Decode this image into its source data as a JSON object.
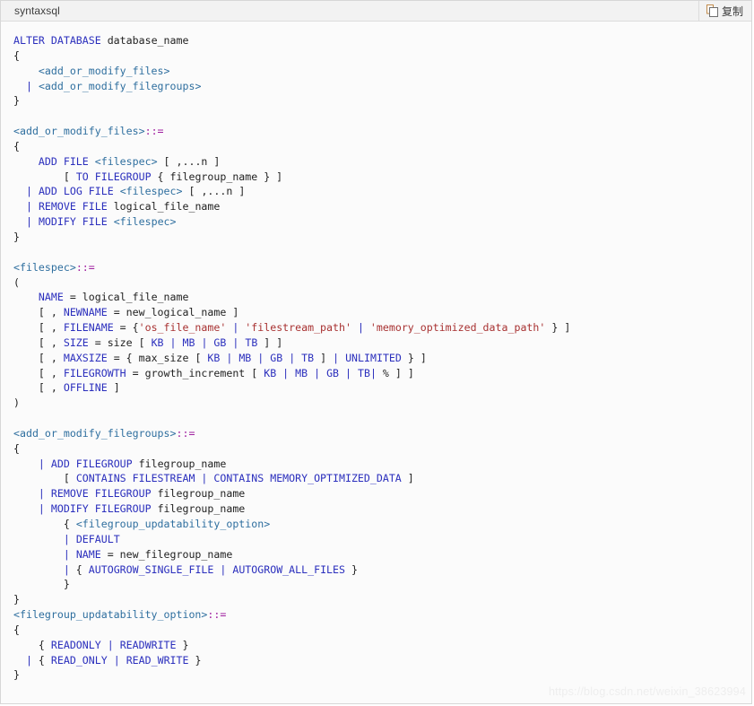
{
  "header": {
    "language_label": "syntaxsql",
    "copy_button_label": "复制",
    "copy_icon": "copy-pages-icon"
  },
  "watermark": {
    "text": "https://blog.csdn.net/weixin_38623994"
  },
  "colors": {
    "keyword": "#2b2fbd",
    "placeholder": "#2f6f9f",
    "operator": "#a020a0",
    "string": "#a83232",
    "plain": "#222222",
    "card_background": "#fbfbfb",
    "header_background": "#f2f2f2",
    "border": "#d7d7d7",
    "watermark": "#eeeeee"
  },
  "code": {
    "language": "syntaxsql",
    "lines": [
      [
        {
          "t": "ALTER DATABASE ",
          "c": "k"
        },
        {
          "t": "database_name",
          "c": "pn"
        }
      ],
      [
        {
          "t": "{",
          "c": "pn"
        }
      ],
      [
        {
          "t": "    ",
          "c": "pn"
        },
        {
          "t": "<add_or_modify_files>",
          "c": "ph"
        }
      ],
      [
        {
          "t": "  ",
          "c": "pn"
        },
        {
          "t": "|",
          "c": "pl"
        },
        {
          "t": " ",
          "c": "pn"
        },
        {
          "t": "<add_or_modify_filegroups>",
          "c": "ph"
        }
      ],
      [
        {
          "t": "}",
          "c": "pn"
        }
      ],
      [],
      [
        {
          "t": "<add_or_modify_files>",
          "c": "ph"
        },
        {
          "t": "::=",
          "c": "op"
        }
      ],
      [
        {
          "t": "{",
          "c": "pn"
        }
      ],
      [
        {
          "t": "    ",
          "c": "pn"
        },
        {
          "t": "ADD FILE ",
          "c": "k"
        },
        {
          "t": "<filespec>",
          "c": "ph"
        },
        {
          "t": " [ ,...n ]",
          "c": "pn"
        }
      ],
      [
        {
          "t": "        [ ",
          "c": "pn"
        },
        {
          "t": "TO FILEGROUP",
          "c": "k"
        },
        {
          "t": " { filegroup_name } ]",
          "c": "pn"
        }
      ],
      [
        {
          "t": "  ",
          "c": "pn"
        },
        {
          "t": "|",
          "c": "pl"
        },
        {
          "t": " ",
          "c": "pn"
        },
        {
          "t": "ADD LOG FILE ",
          "c": "k"
        },
        {
          "t": "<filespec>",
          "c": "ph"
        },
        {
          "t": " [ ,...n ]",
          "c": "pn"
        }
      ],
      [
        {
          "t": "  ",
          "c": "pn"
        },
        {
          "t": "|",
          "c": "pl"
        },
        {
          "t": " ",
          "c": "pn"
        },
        {
          "t": "REMOVE FILE ",
          "c": "k"
        },
        {
          "t": "logical_file_name",
          "c": "pn"
        }
      ],
      [
        {
          "t": "  ",
          "c": "pn"
        },
        {
          "t": "|",
          "c": "pl"
        },
        {
          "t": " ",
          "c": "pn"
        },
        {
          "t": "MODIFY FILE ",
          "c": "k"
        },
        {
          "t": "<filespec>",
          "c": "ph"
        }
      ],
      [
        {
          "t": "}",
          "c": "pn"
        }
      ],
      [],
      [
        {
          "t": "<filespec>",
          "c": "ph"
        },
        {
          "t": "::=",
          "c": "op"
        }
      ],
      [
        {
          "t": "(",
          "c": "pn"
        }
      ],
      [
        {
          "t": "    ",
          "c": "pn"
        },
        {
          "t": "NAME",
          "c": "k"
        },
        {
          "t": " = logical_file_name",
          "c": "pn"
        }
      ],
      [
        {
          "t": "    [ , ",
          "c": "pn"
        },
        {
          "t": "NEWNAME",
          "c": "k"
        },
        {
          "t": " = new_logical_name ]",
          "c": "pn"
        }
      ],
      [
        {
          "t": "    [ , ",
          "c": "pn"
        },
        {
          "t": "FILENAME",
          "c": "k"
        },
        {
          "t": " = {",
          "c": "pn"
        },
        {
          "t": "'os_file_name'",
          "c": "st"
        },
        {
          "t": " ",
          "c": "pn"
        },
        {
          "t": "|",
          "c": "pl"
        },
        {
          "t": " ",
          "c": "pn"
        },
        {
          "t": "'filestream_path'",
          "c": "st"
        },
        {
          "t": " ",
          "c": "pn"
        },
        {
          "t": "|",
          "c": "pl"
        },
        {
          "t": " ",
          "c": "pn"
        },
        {
          "t": "'memory_optimized_data_path'",
          "c": "st"
        },
        {
          "t": " } ]",
          "c": "pn"
        }
      ],
      [
        {
          "t": "    [ , ",
          "c": "pn"
        },
        {
          "t": "SIZE",
          "c": "k"
        },
        {
          "t": " = size [ ",
          "c": "pn"
        },
        {
          "t": "KB",
          "c": "k"
        },
        {
          "t": " ",
          "c": "pn"
        },
        {
          "t": "|",
          "c": "pl"
        },
        {
          "t": " ",
          "c": "pn"
        },
        {
          "t": "MB",
          "c": "k"
        },
        {
          "t": " ",
          "c": "pn"
        },
        {
          "t": "|",
          "c": "pl"
        },
        {
          "t": " ",
          "c": "pn"
        },
        {
          "t": "GB",
          "c": "k"
        },
        {
          "t": " ",
          "c": "pn"
        },
        {
          "t": "|",
          "c": "pl"
        },
        {
          "t": " ",
          "c": "pn"
        },
        {
          "t": "TB",
          "c": "k"
        },
        {
          "t": " ] ]",
          "c": "pn"
        }
      ],
      [
        {
          "t": "    [ , ",
          "c": "pn"
        },
        {
          "t": "MAXSIZE",
          "c": "k"
        },
        {
          "t": " = { max_size [ ",
          "c": "pn"
        },
        {
          "t": "KB",
          "c": "k"
        },
        {
          "t": " ",
          "c": "pn"
        },
        {
          "t": "|",
          "c": "pl"
        },
        {
          "t": " ",
          "c": "pn"
        },
        {
          "t": "MB",
          "c": "k"
        },
        {
          "t": " ",
          "c": "pn"
        },
        {
          "t": "|",
          "c": "pl"
        },
        {
          "t": " ",
          "c": "pn"
        },
        {
          "t": "GB",
          "c": "k"
        },
        {
          "t": " ",
          "c": "pn"
        },
        {
          "t": "|",
          "c": "pl"
        },
        {
          "t": " ",
          "c": "pn"
        },
        {
          "t": "TB",
          "c": "k"
        },
        {
          "t": " ] ",
          "c": "pn"
        },
        {
          "t": "|",
          "c": "pl"
        },
        {
          "t": " ",
          "c": "pn"
        },
        {
          "t": "UNLIMITED",
          "c": "k"
        },
        {
          "t": " } ]",
          "c": "pn"
        }
      ],
      [
        {
          "t": "    [ , ",
          "c": "pn"
        },
        {
          "t": "FILEGROWTH",
          "c": "k"
        },
        {
          "t": " = growth_increment [ ",
          "c": "pn"
        },
        {
          "t": "KB",
          "c": "k"
        },
        {
          "t": " ",
          "c": "pn"
        },
        {
          "t": "|",
          "c": "pl"
        },
        {
          "t": " ",
          "c": "pn"
        },
        {
          "t": "MB",
          "c": "k"
        },
        {
          "t": " ",
          "c": "pn"
        },
        {
          "t": "|",
          "c": "pl"
        },
        {
          "t": " ",
          "c": "pn"
        },
        {
          "t": "GB",
          "c": "k"
        },
        {
          "t": " ",
          "c": "pn"
        },
        {
          "t": "|",
          "c": "pl"
        },
        {
          "t": " ",
          "c": "pn"
        },
        {
          "t": "TB",
          "c": "k"
        },
        {
          "t": "|",
          "c": "pl"
        },
        {
          "t": " % ] ]",
          "c": "pn"
        }
      ],
      [
        {
          "t": "    [ , ",
          "c": "pn"
        },
        {
          "t": "OFFLINE",
          "c": "k"
        },
        {
          "t": " ]",
          "c": "pn"
        }
      ],
      [
        {
          "t": ")",
          "c": "pn"
        }
      ],
      [],
      [
        {
          "t": "<add_or_modify_filegroups>",
          "c": "ph"
        },
        {
          "t": "::=",
          "c": "op"
        }
      ],
      [
        {
          "t": "{",
          "c": "pn"
        }
      ],
      [
        {
          "t": "    ",
          "c": "pn"
        },
        {
          "t": "|",
          "c": "pl"
        },
        {
          "t": " ",
          "c": "pn"
        },
        {
          "t": "ADD FILEGROUP ",
          "c": "k"
        },
        {
          "t": "filegroup_name",
          "c": "pn"
        }
      ],
      [
        {
          "t": "        [ ",
          "c": "pn"
        },
        {
          "t": "CONTAINS FILESTREAM",
          "c": "k"
        },
        {
          "t": " ",
          "c": "pn"
        },
        {
          "t": "|",
          "c": "pl"
        },
        {
          "t": " ",
          "c": "pn"
        },
        {
          "t": "CONTAINS MEMORY_OPTIMIZED_DATA",
          "c": "k"
        },
        {
          "t": " ]",
          "c": "pn"
        }
      ],
      [
        {
          "t": "    ",
          "c": "pn"
        },
        {
          "t": "|",
          "c": "pl"
        },
        {
          "t": " ",
          "c": "pn"
        },
        {
          "t": "REMOVE FILEGROUP ",
          "c": "k"
        },
        {
          "t": "filegroup_name",
          "c": "pn"
        }
      ],
      [
        {
          "t": "    ",
          "c": "pn"
        },
        {
          "t": "|",
          "c": "pl"
        },
        {
          "t": " ",
          "c": "pn"
        },
        {
          "t": "MODIFY FILEGROUP ",
          "c": "k"
        },
        {
          "t": "filegroup_name",
          "c": "pn"
        }
      ],
      [
        {
          "t": "        { ",
          "c": "pn"
        },
        {
          "t": "<filegroup_updatability_option>",
          "c": "ph"
        }
      ],
      [
        {
          "t": "        ",
          "c": "pn"
        },
        {
          "t": "|",
          "c": "pl"
        },
        {
          "t": " ",
          "c": "pn"
        },
        {
          "t": "DEFAULT",
          "c": "k"
        }
      ],
      [
        {
          "t": "        ",
          "c": "pn"
        },
        {
          "t": "|",
          "c": "pl"
        },
        {
          "t": " ",
          "c": "pn"
        },
        {
          "t": "NAME",
          "c": "k"
        },
        {
          "t": " = new_filegroup_name",
          "c": "pn"
        }
      ],
      [
        {
          "t": "        ",
          "c": "pn"
        },
        {
          "t": "|",
          "c": "pl"
        },
        {
          "t": " { ",
          "c": "pn"
        },
        {
          "t": "AUTOGROW_SINGLE_FILE",
          "c": "k"
        },
        {
          "t": " ",
          "c": "pn"
        },
        {
          "t": "|",
          "c": "pl"
        },
        {
          "t": " ",
          "c": "pn"
        },
        {
          "t": "AUTOGROW_ALL_FILES",
          "c": "k"
        },
        {
          "t": " }",
          "c": "pn"
        }
      ],
      [
        {
          "t": "        }",
          "c": "pn"
        }
      ],
      [
        {
          "t": "}",
          "c": "pn"
        }
      ],
      [
        {
          "t": "<filegroup_updatability_option>",
          "c": "ph"
        },
        {
          "t": "::=",
          "c": "op"
        }
      ],
      [
        {
          "t": "{",
          "c": "pn"
        }
      ],
      [
        {
          "t": "    { ",
          "c": "pn"
        },
        {
          "t": "READONLY",
          "c": "k"
        },
        {
          "t": " ",
          "c": "pn"
        },
        {
          "t": "|",
          "c": "pl"
        },
        {
          "t": " ",
          "c": "pn"
        },
        {
          "t": "READWRITE",
          "c": "k"
        },
        {
          "t": " }",
          "c": "pn"
        }
      ],
      [
        {
          "t": "  ",
          "c": "pn"
        },
        {
          "t": "|",
          "c": "pl"
        },
        {
          "t": " { ",
          "c": "pn"
        },
        {
          "t": "READ_ONLY",
          "c": "k"
        },
        {
          "t": " ",
          "c": "pn"
        },
        {
          "t": "|",
          "c": "pl"
        },
        {
          "t": " ",
          "c": "pn"
        },
        {
          "t": "READ_WRITE",
          "c": "k"
        },
        {
          "t": " }",
          "c": "pn"
        }
      ],
      [
        {
          "t": "}",
          "c": "pn"
        }
      ]
    ]
  }
}
